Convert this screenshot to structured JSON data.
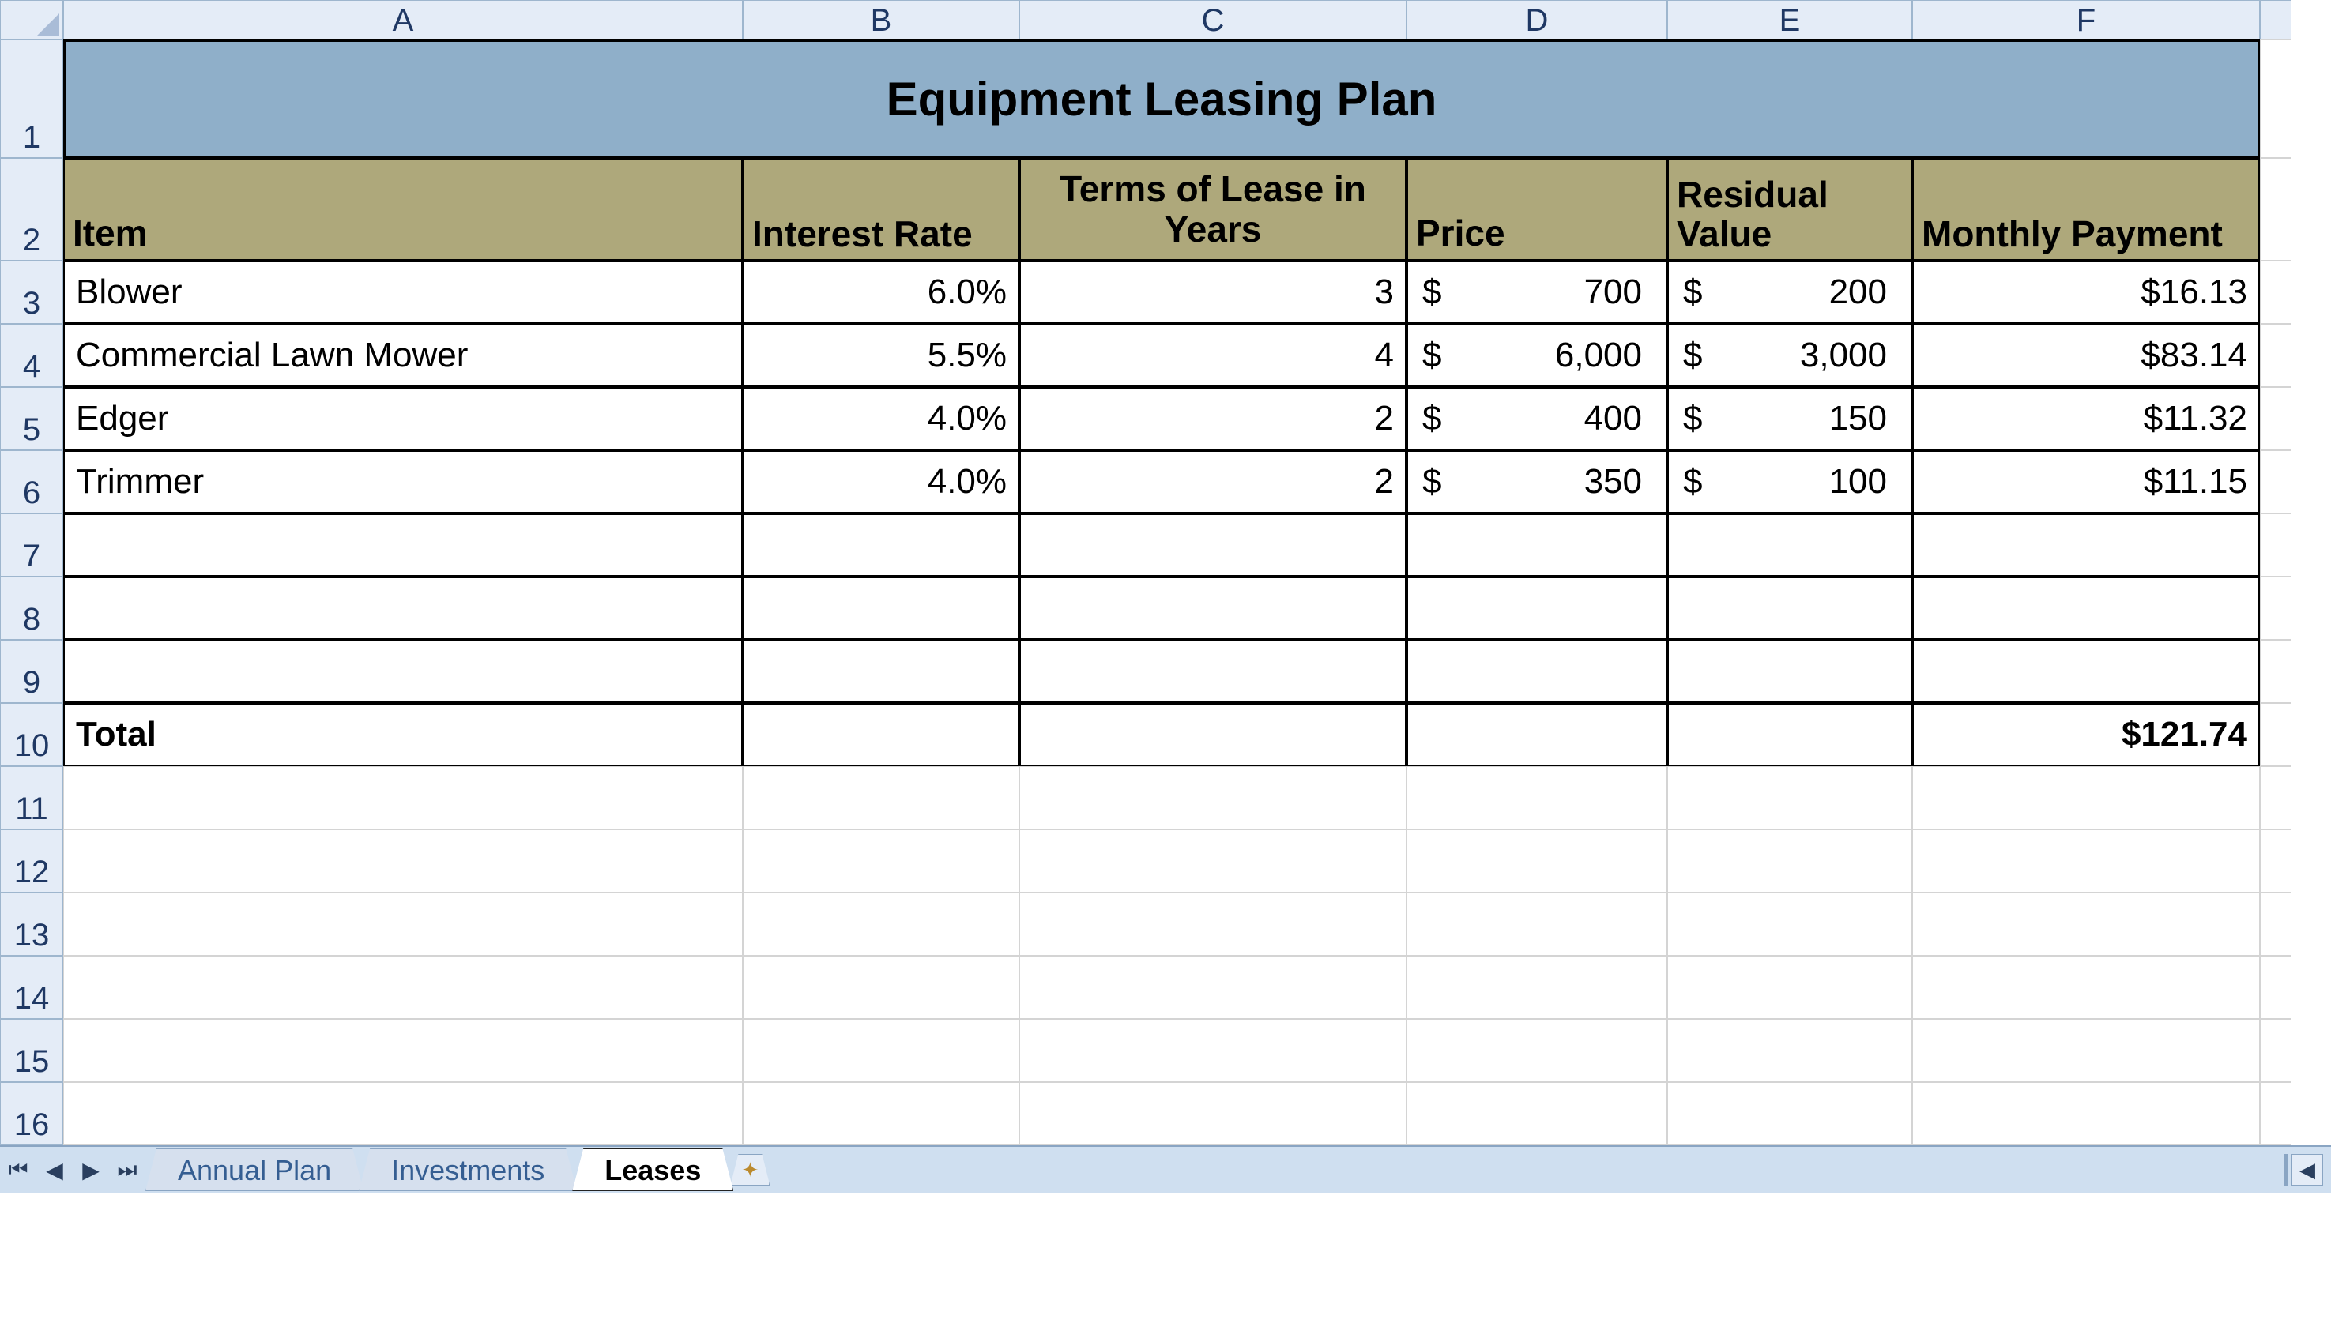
{
  "columns": [
    "A",
    "B",
    "C",
    "D",
    "E",
    "F"
  ],
  "rows": [
    "1",
    "2",
    "3",
    "4",
    "5",
    "6",
    "7",
    "8",
    "9",
    "10",
    "11",
    "12",
    "13",
    "14",
    "15",
    "16"
  ],
  "title": "Equipment Leasing Plan",
  "headers": {
    "item": "Item",
    "rate": "Interest Rate",
    "terms": "Terms of Lease in Years",
    "price": "Price",
    "residual": "Residual Value",
    "payment": "Monthly Payment"
  },
  "data": [
    {
      "item": "Blower",
      "rate": "6.0%",
      "terms": "3",
      "price": "700",
      "residual": "200",
      "payment": "$16.13"
    },
    {
      "item": "Commercial Lawn Mower",
      "rate": "5.5%",
      "terms": "4",
      "price": "6,000",
      "residual": "3,000",
      "payment": "$83.14"
    },
    {
      "item": "Edger",
      "rate": "4.0%",
      "terms": "2",
      "price": "400",
      "residual": "150",
      "payment": "$11.32"
    },
    {
      "item": "Trimmer",
      "rate": "4.0%",
      "terms": "2",
      "price": "350",
      "residual": "100",
      "payment": "$11.15"
    }
  ],
  "total": {
    "label": "Total",
    "payment": "$121.74"
  },
  "tabs": {
    "list": [
      "Annual Plan",
      "Investments",
      "Leases"
    ],
    "active": "Leases"
  },
  "chart_data": {
    "type": "table",
    "title": "Equipment Leasing Plan",
    "columns": [
      "Item",
      "Interest Rate",
      "Terms of Lease in Years",
      "Price",
      "Residual Value",
      "Monthly Payment"
    ],
    "rows": [
      [
        "Blower",
        "6.0%",
        3,
        700,
        200,
        16.13
      ],
      [
        "Commercial Lawn Mower",
        "5.5%",
        4,
        6000,
        3000,
        83.14
      ],
      [
        "Edger",
        "4.0%",
        2,
        400,
        150,
        11.32
      ],
      [
        "Trimmer",
        "4.0%",
        2,
        350,
        100,
        11.15
      ]
    ],
    "total_row": [
      "Total",
      "",
      "",
      "",
      "",
      121.74
    ]
  }
}
